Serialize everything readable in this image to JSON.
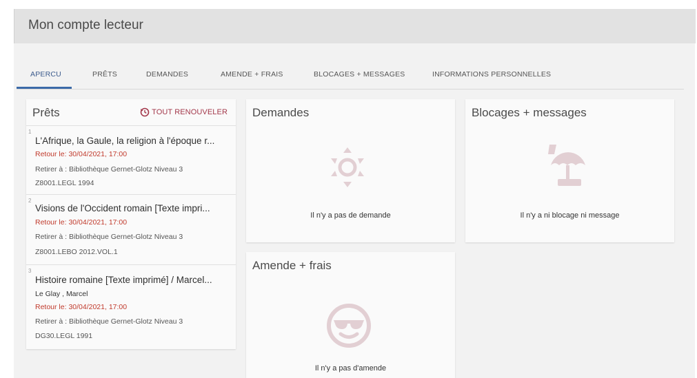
{
  "header": {
    "title": "Mon compte lecteur"
  },
  "tabs": [
    {
      "label": "APERCU"
    },
    {
      "label": "PRÊTS"
    },
    {
      "label": "DEMANDES"
    },
    {
      "label": "AMENDE + FRAIS"
    },
    {
      "label": "BLOCAGES + MESSAGES"
    },
    {
      "label": "INFORMATIONS PERSONNELLES"
    }
  ],
  "loans": {
    "title": "Prêts",
    "renew_all": "TOUT RENOUVELER",
    "items": [
      {
        "num": "1",
        "title": "L'Afrique, la Gaule, la religion à l'époque r...",
        "due": "Retour le: 30/04/2021, 17:00",
        "pickup": "Retirer à : Bibliothèque Gernet-Glotz Niveau 3",
        "callnumber": "Z8001.LEGL 1994"
      },
      {
        "num": "2",
        "title": "Visions de l'Occident romain [Texte impri...",
        "due": "Retour le: 30/04/2021, 17:00",
        "pickup": "Retirer à : Bibliothèque Gernet-Glotz Niveau 3",
        "callnumber": "Z8001.LEBO 2012.VOL.1"
      },
      {
        "num": "3",
        "title": "Histoire romaine [Texte imprimé] / Marcel...",
        "author": "Le Glay , Marcel",
        "due": "Retour le: 30/04/2021, 17:00",
        "pickup": "Retirer à : Bibliothèque Gernet-Glotz Niveau 3",
        "callnumber": "DG30.LEGL 1991"
      }
    ]
  },
  "requests": {
    "title": "Demandes",
    "empty": "Il n'y a pas de demande",
    "icon": "sun-icon"
  },
  "blocks": {
    "title": "Blocages + messages",
    "empty": "Il n'y a ni blocage ni message",
    "icon": "beach-umbrella-icon"
  },
  "fines": {
    "title": "Amende + frais",
    "empty": "Il n'y a pas d'amende",
    "icon": "sunglasses-face-icon"
  },
  "colors": {
    "accent": "#3b6aa8",
    "renew": "#a3384b",
    "due": "#c0392b",
    "icon": "#e2cfd3"
  }
}
